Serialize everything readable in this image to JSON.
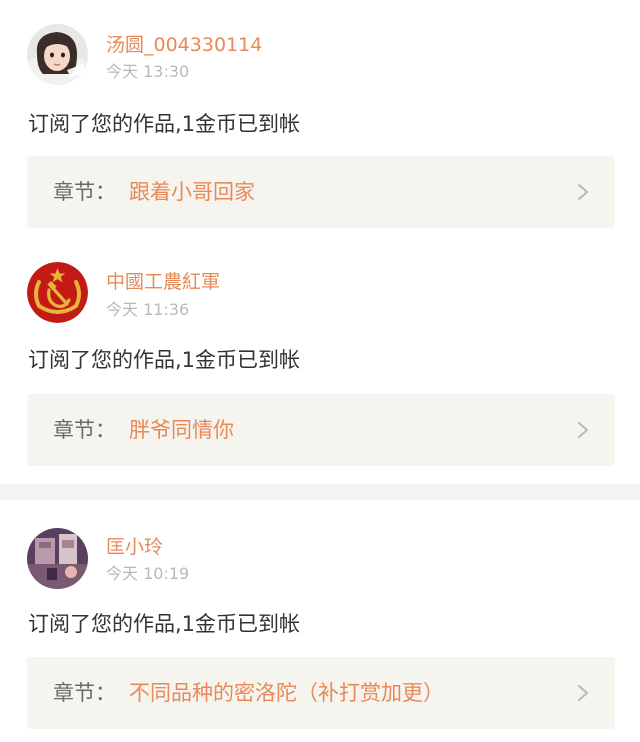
{
  "items": [
    {
      "username": "汤圆_004330114",
      "time": "今天 13:30",
      "message": "订阅了您的作品,1金币已到帐",
      "chapter_label": "章节：",
      "chapter_title": "跟着小哥回家",
      "avatar_icon": "girl-photo-avatar"
    },
    {
      "username": "中國工農紅軍",
      "time": "今天 11:36",
      "message": "订阅了您的作品,1金币已到帐",
      "chapter_label": "章节：",
      "chapter_title": "胖爷同情你",
      "avatar_icon": "hammer-sickle-emblem-avatar"
    },
    {
      "username": "匡小玲",
      "time": "今天 10:19",
      "message": "订阅了您的作品,1金币已到帐",
      "chapter_label": "章节：",
      "chapter_title": "不同品种的密洛陀（补打赏加更）",
      "avatar_icon": "purple-photo-avatar"
    }
  ],
  "colors": {
    "username": "#e8895a",
    "chapter_title": "#e8895a",
    "chapter_bg": "#f5f4ef",
    "time": "#b9b9b9",
    "message": "#333333",
    "divider": "#f5f5f5"
  }
}
